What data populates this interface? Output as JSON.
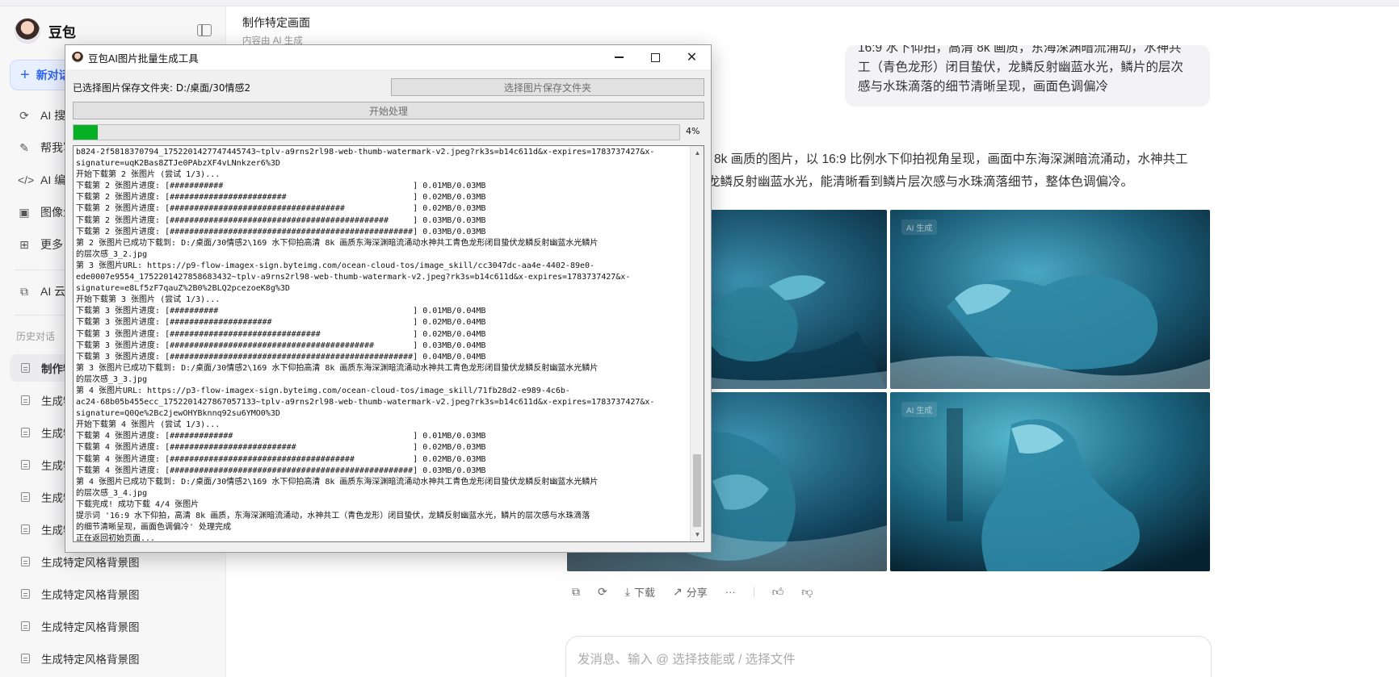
{
  "sidebar": {
    "brand": "豆包",
    "new_chat": "新对话",
    "nav": [
      {
        "label": "AI 搜索",
        "icon": "refresh-search-icon"
      },
      {
        "label": "帮我写作",
        "icon": "pen-icon"
      },
      {
        "label": "AI 编程",
        "icon": "code-icon"
      },
      {
        "label": "图像生成",
        "icon": "image-icon"
      },
      {
        "label": "更多",
        "icon": "grid-icon"
      },
      {
        "label": "AI 云盘",
        "icon": "cloud-icon"
      }
    ],
    "history_label": "历史对话",
    "history": [
      "制作特定画面",
      "生成特定风格背景图",
      "生成特定风格背景图",
      "生成特定风格背景图",
      "生成特定风格背景图",
      "生成特定风格背景图",
      "生成特定风格背景图",
      "生成特定风格背景图",
      "生成特定风格背景图",
      "生成特定风格背景图"
    ]
  },
  "main": {
    "title": "制作特定画面",
    "subtitle": "内容由 AI 生成",
    "prompt_lines": [
      "16:9 水下仰拍，高清 8k 画质，东海深渊暗流涌动，水神共",
      "工（青色龙形）闭目蛰伏，龙鳞反射幽蓝水光，鳞片的层次",
      "感与水珠滴落的细节清晰呈现，画面色调偏冷"
    ],
    "answer_lines": [
      "8k 画质的图片，以 16:9 比例水下仰拍视角呈现，画面中东海深渊暗流涌动，水神共工",
      "龙鳞反射幽蓝水光，能清晰看到鳞片层次感与水珠滴落细节，整体色调偏冷。"
    ],
    "image_tag": "AI 生成",
    "actions": {
      "download": "下载",
      "share": "分享",
      "more": "···"
    },
    "composer_placeholder": "发消息、输入 @ 选择技能或 / 选择文件"
  },
  "dialog": {
    "title": "豆包AI图片批量生成工具",
    "folder_label": "已选择图片保存文件夹: D:/桌面/30情感2",
    "select_folder_button": "选择图片保存文件夹",
    "start_button": "开始处理",
    "progress_percent": 4,
    "progress_text": "4%",
    "log_lines": [
      "b824-2f5818370794_1752201427747445743~tplv-a9rns2rl98-web-thumb-watermark-v2.jpeg?rk3s=b14c611d&x-expires=1783737427&x-",
      "signature=uqK2Bas8ZTJe0PAbzXF4vLNnkzer6%3D",
      "开始下载第 2 张图片 (尝试 1/3)...",
      "下载第 2 张图片进度: [###########                                       ] 0.01MB/0.03MB",
      "下载第 2 张图片进度: [########################                          ] 0.02MB/0.03MB",
      "下载第 2 张图片进度: [####################################              ] 0.02MB/0.03MB",
      "下载第 2 张图片进度: [#############################################     ] 0.03MB/0.03MB",
      "下载第 2 张图片进度: [##################################################] 0.03MB/0.03MB",
      "第 2 张图片已成功下载到: D:/桌面/30情感2\\169 水下仰拍高清 8k 画质东海深渊暗流涌动水神共工青色龙形闭目蛰伏龙鳞反射幽蓝水光鳞片",
      "的层次感_3_2.jpg",
      "第 3 张图片URL: https://p9-flow-imagex-sign.byteimg.com/ocean-cloud-tos/image_skill/cc3047dc-aa4e-4402-89e0-",
      "ede0007e9554_1752201427858683432~tplv-a9rns2rl98-web-thumb-watermark-v2.jpeg?rk3s=b14c611d&x-expires=1783737427&x-",
      "signature=e8Lf5zF7qauZ%2B0%2BLQ2pcezoeK8g%3D",
      "开始下载第 3 张图片 (尝试 1/3)...",
      "下载第 3 张图片进度: [##########                                        ] 0.01MB/0.04MB",
      "下载第 3 张图片进度: [#####################                             ] 0.02MB/0.04MB",
      "下载第 3 张图片进度: [###############################                   ] 0.02MB/0.04MB",
      "下载第 3 张图片进度: [##########################################        ] 0.03MB/0.04MB",
      "下载第 3 张图片进度: [##################################################] 0.04MB/0.04MB",
      "第 3 张图片已成功下载到: D:/桌面/30情感2\\169 水下仰拍高清 8k 画质东海深渊暗流涌动水神共工青色龙形闭目蛰伏龙鳞反射幽蓝水光鳞片",
      "的层次感_3_3.jpg",
      "第 4 张图片URL: https://p3-flow-imagex-sign.byteimg.com/ocean-cloud-tos/image_skill/71fb28d2-e989-4c6b-",
      "ac24-68b05b455ecc_1752201427867057133~tplv-a9rns2rl98-web-thumb-watermark-v2.jpeg?rk3s=b14c611d&x-expires=1783737427&x-",
      "signature=Q0Qe%2Bc2jewOHYBknnq92su6YMO0%3D",
      "开始下载第 4 张图片 (尝试 1/3)...",
      "下载第 4 张图片进度: [#############                                     ] 0.01MB/0.03MB",
      "下载第 4 张图片进度: [##########################                        ] 0.02MB/0.03MB",
      "下载第 4 张图片进度: [######################################            ] 0.02MB/0.03MB",
      "下载第 4 张图片进度: [##################################################] 0.03MB/0.03MB",
      "第 4 张图片已成功下载到: D:/桌面/30情感2\\169 水下仰拍高清 8k 画质东海深渊暗流涌动水神共工青色龙形闭目蛰伏龙鳞反射幽蓝水光鳞片",
      "的层次感_3_4.jpg",
      "下载完成! 成功下载 4/4 张图片",
      "提示词 '16:9 水下仰拍，高清 8k 画质，东海深渊暗流涌动，水神共工（青色龙形）闭目蛰伏，龙鳞反射幽蓝水光，鳞片的层次感与水珠滴落",
      "的细节清晰呈现，画面色调偏冷' 处理完成",
      "正在返回初始页面..."
    ]
  },
  "colors": {
    "accent": "#2f65f2",
    "progress": "#06b025",
    "image_deep": "#0b2a3a",
    "image_glow": "#3fa6c2"
  }
}
